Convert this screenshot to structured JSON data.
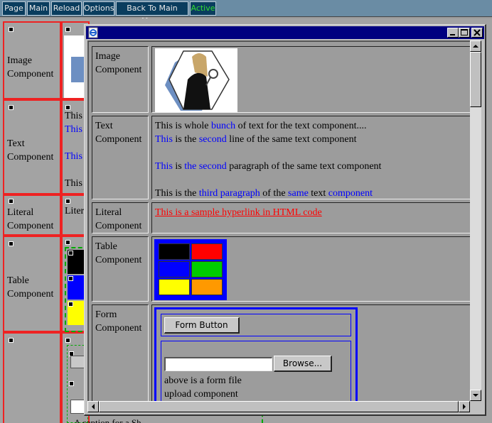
{
  "menu": {
    "items": [
      {
        "label": "Page",
        "state": "normal"
      },
      {
        "label": "Main",
        "state": "normal"
      },
      {
        "label": "Reload",
        "state": "normal"
      },
      {
        "label": "Options",
        "state": "normal"
      },
      {
        "label": "Back To Main Menu",
        "state": "normal"
      },
      {
        "label": "Active",
        "state": "active"
      }
    ]
  },
  "background": {
    "labels": {
      "image": "Image Component",
      "text": "Text Component",
      "literal": "Literal Component",
      "table": "Table Component"
    },
    "snippets": {
      "text1": "This",
      "text2": "This",
      "text3": "This",
      "text4": "This",
      "literal": "Liter",
      "form_caption": "A caption for a Sh"
    }
  },
  "window": {
    "icon": "ie-page-icon",
    "rows": {
      "image": {
        "label": "Image Component",
        "image_alt": "woman-with-magnifier-photo"
      },
      "text": {
        "label": "Text Component",
        "lines": {
          "l1a": "This is whole ",
          "l1b": "bunch",
          "l1c": " of text for the text component....",
          "l2a": "This",
          "l2b": " is the ",
          "l2c": "second",
          "l2d": " line of the same text component",
          "l3a": "This",
          "l3b": " is ",
          "l3c": "the second",
          "l3d": " paragraph of the same text component",
          "l4a": "This is the ",
          "l4b": "third paragraph",
          "l4c": " of the ",
          "l4d": "same",
          "l4e": " text ",
          "l4f": "component"
        }
      },
      "literal": {
        "label": "Literal Component",
        "link": "This is a sample hyperlink in HTML code"
      },
      "table": {
        "label": "Table Component",
        "colors": [
          "#000000",
          "#ff0000",
          "#0000ff",
          "#00cc00",
          "#ffff00",
          "#ff9900"
        ]
      },
      "form": {
        "label": "Form Component",
        "button": "Form Button",
        "file_value": "",
        "browse": "Browse...",
        "caption": "above is a form file upload component"
      }
    }
  }
}
